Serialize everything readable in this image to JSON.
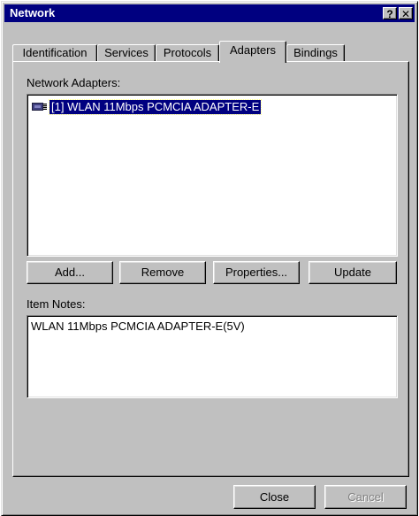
{
  "window": {
    "title": "Network",
    "help_glyph": "?",
    "close_glyph": "✕"
  },
  "tabs": [
    {
      "label": "Identification"
    },
    {
      "label": "Services"
    },
    {
      "label": "Protocols"
    },
    {
      "label": "Adapters"
    },
    {
      "label": "Bindings"
    }
  ],
  "adapters": {
    "list_label": "Network Adapters:",
    "items": [
      {
        "label": "[1] WLAN 11Mbps PCMCIA ADAPTER-E",
        "icon": "network-adapter-icon"
      }
    ],
    "buttons": {
      "add": "Add...",
      "remove": "Remove",
      "properties": "Properties...",
      "update": "Update"
    },
    "notes_label": "Item Notes:",
    "notes_text": "WLAN 11Mbps PCMCIA ADAPTER-E(5V)"
  },
  "footer": {
    "close": "Close",
    "cancel": "Cancel"
  },
  "colors": {
    "titlebar": "#000080",
    "face": "#c0c0c0",
    "selection": "#000080",
    "disabled_text": "#808080"
  }
}
